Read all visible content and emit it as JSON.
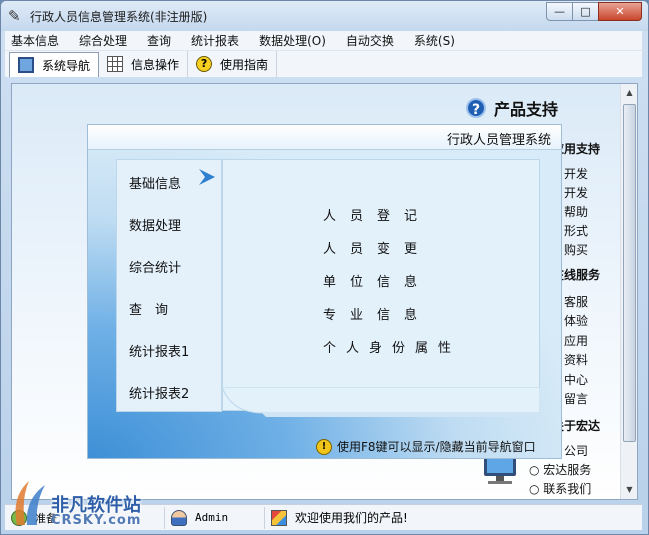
{
  "window": {
    "title": "行政人员信息管理系统(非注册版)",
    "min_glyph": "—",
    "max_glyph": "□",
    "close_glyph": "✕"
  },
  "menu": [
    {
      "label": "基本信息"
    },
    {
      "label": "综合处理"
    },
    {
      "label": "查询"
    },
    {
      "label": "统计报表"
    },
    {
      "label": "数据处理(O)"
    },
    {
      "label": "自动交换"
    },
    {
      "label": "系统(S)"
    }
  ],
  "toolbar": [
    {
      "label": "系统导航",
      "icon": "monitor-icon"
    },
    {
      "label": "信息操作",
      "icon": "grid-icon"
    },
    {
      "label": "使用指南",
      "icon": "help-icon"
    }
  ],
  "support": {
    "title": "产品支持",
    "icon_glyph": "?",
    "sections": [
      "应用支持",
      "在线服务",
      "关于宏达"
    ],
    "links_1": [
      "开发",
      "开发",
      "帮助",
      "形式",
      "购买"
    ],
    "links_2": [
      "客服",
      "体验",
      "应用",
      "资料",
      "中心",
      "留言"
    ],
    "links_3": [
      "公司",
      "○ 宏达服务",
      "○ 联系我们"
    ]
  },
  "nav_panel": {
    "header": "行政人员管理系统",
    "left_items": [
      "基础信息",
      "数据处理",
      "综合统计",
      "查　询",
      "统计报表1",
      "统计报表2"
    ],
    "right_items": [
      "人员登记",
      "人员变更",
      "单位信息",
      "专业信息",
      "个人身份属性"
    ],
    "tip": "使用F8键可以显示/隐藏当前导航窗口",
    "tip_icon_glyph": "!"
  },
  "status": {
    "ready": "准备",
    "user": "Admin",
    "welcome": "欢迎使用我们的产品!"
  },
  "watermark": {
    "text_cn": "非凡软件站",
    "text_en": "CRSKY.com"
  },
  "scrollbar": {
    "up_glyph": "▲",
    "down_glyph": "▼"
  },
  "colors": {
    "accent": "#1f5fb3",
    "panel_bg": "#d8ebf8",
    "titlebar": "#c4d8ee"
  }
}
